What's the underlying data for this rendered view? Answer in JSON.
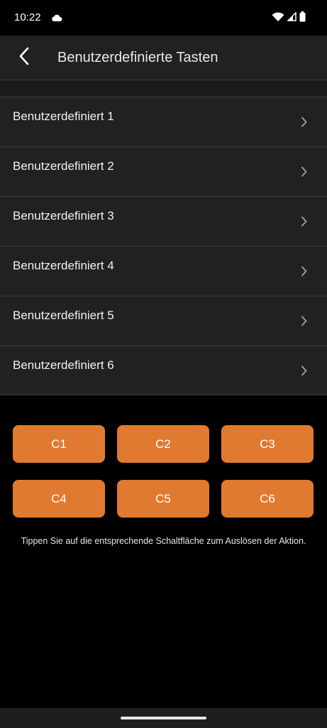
{
  "status_bar": {
    "time": "10:22",
    "icons": [
      "cloud-icon",
      "wifi-icon",
      "cellular-signal-icon",
      "battery-icon"
    ]
  },
  "app_bar": {
    "title": "Benutzerdefinierte Tasten",
    "back_icon": "chevron-left-icon"
  },
  "list": {
    "items": [
      {
        "label": "Benutzerdefiniert 1"
      },
      {
        "label": "Benutzerdefiniert 2"
      },
      {
        "label": "Benutzerdefiniert 3"
      },
      {
        "label": "Benutzerdefiniert 4"
      },
      {
        "label": "Benutzerdefiniert 5"
      },
      {
        "label": "Benutzerdefiniert 6"
      }
    ],
    "item_icon": "chevron-right-icon"
  },
  "buttons": {
    "items": [
      {
        "label": "C1"
      },
      {
        "label": "C2"
      },
      {
        "label": "C3"
      },
      {
        "label": "C4"
      },
      {
        "label": "C5"
      },
      {
        "label": "C6"
      }
    ]
  },
  "hint": "Tippen Sie auf die entsprechende Schaltfläche zum Auslösen der Aktion.",
  "colors": {
    "background": "#000000",
    "surface": "#212121",
    "accent": "#e07a30",
    "divider": "#3a3a3a"
  }
}
